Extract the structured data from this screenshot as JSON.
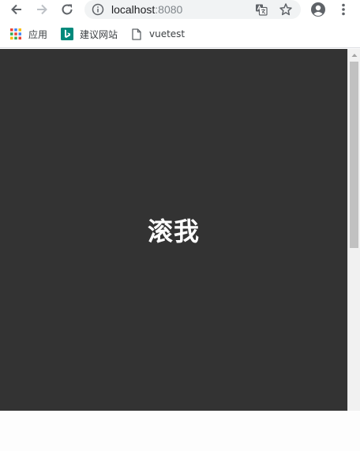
{
  "toolbar": {
    "url_host": "localhost",
    "url_port": ":8080",
    "icons": [
      "back-arrow-icon",
      "forward-arrow-icon",
      "reload-icon",
      "info-icon",
      "translate-icon",
      "star-icon",
      "account-icon",
      "menu-icon"
    ]
  },
  "bookmarks": {
    "items": [
      {
        "label": "应用",
        "icon": "apps-grid-icon"
      },
      {
        "label": "建议网站",
        "icon": "bing-icon"
      },
      {
        "label": "vuetest",
        "icon": "page-icon"
      }
    ]
  },
  "page": {
    "hero_text": "滚我",
    "hero_bg": "#333333",
    "hero_color": "#ffffff"
  }
}
